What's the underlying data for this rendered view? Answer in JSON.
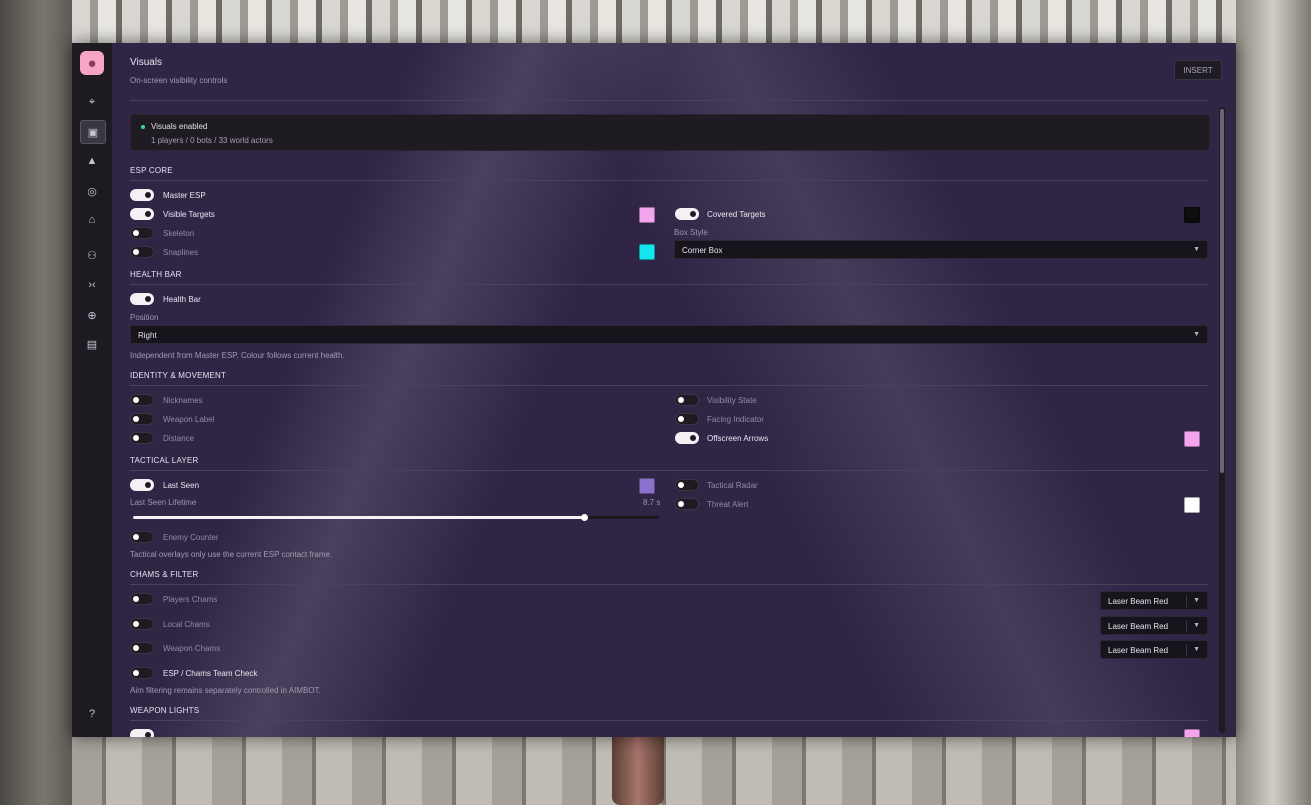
{
  "header": {
    "title": "Visuals",
    "subtitle": "On-screen visibility controls",
    "insert_label": "INSERT"
  },
  "status": {
    "title": "Visuals enabled",
    "counts": "1 players  /  0 bots  /  33 world actors"
  },
  "sidebar": {
    "logo_icon": "cat-face-icon",
    "items": [
      {
        "icon": "crosshair-icon",
        "glyph": "⌖",
        "active": false
      },
      {
        "icon": "visuals-icon",
        "glyph": "▣",
        "active": true
      },
      {
        "icon": "warning-icon",
        "glyph": "▲",
        "active": false
      },
      {
        "icon": "target-icon",
        "glyph": "◎",
        "active": false
      },
      {
        "icon": "inbox-icon",
        "glyph": "⌂",
        "active": false
      },
      {
        "icon": "users-icon",
        "glyph": "⚇",
        "active": false
      },
      {
        "icon": "code-icon",
        "glyph": "›‹",
        "active": false
      },
      {
        "icon": "settings-icon",
        "glyph": "⊕",
        "active": false
      },
      {
        "icon": "media-icon",
        "glyph": "▤",
        "active": false
      }
    ],
    "help_icon": "help-icon"
  },
  "sections": {
    "esp_core": "ESP CORE",
    "health_bar": "HEALTH BAR",
    "identity": "IDENTITY & MOVEMENT",
    "tactical": "TACTICAL LAYER",
    "chams": "CHAMS & FILTER",
    "weapon_lights": "WEAPON LIGHTS"
  },
  "esp_core": {
    "master_esp": {
      "label": "Master ESP",
      "on": true
    },
    "visible_targets": {
      "label": "Visible Targets",
      "on": true,
      "color": "#f3a6ef"
    },
    "skeleton": {
      "label": "Skeleton",
      "on": false
    },
    "snaplines": {
      "label": "Snaplines",
      "on": false,
      "color": "#16e6f0"
    },
    "covered_targets": {
      "label": "Covered Targets",
      "on": true,
      "color": "#0d0d0f"
    },
    "box_style": {
      "caption": "Box Style",
      "value": "Corner Box"
    }
  },
  "health_bar": {
    "toggle": {
      "label": "Health Bar",
      "on": true
    },
    "position": {
      "caption": "Position",
      "value": "Right"
    },
    "note": "Independent from Master ESP. Colour follows current health."
  },
  "identity": {
    "nicknames": {
      "label": "Nicknames",
      "on": false
    },
    "weapon_label": {
      "label": "Weapon Label",
      "on": false
    },
    "distance": {
      "label": "Distance",
      "on": false
    },
    "visibility_state": {
      "label": "Visibility State",
      "on": false
    },
    "facing_indicator": {
      "label": "Facing Indicator",
      "on": false
    },
    "offscreen_arrows": {
      "label": "Offscreen Arrows",
      "on": true,
      "color": "#f3a6ef"
    }
  },
  "tactical": {
    "last_seen": {
      "label": "Last Seen",
      "on": true,
      "color": "#8a73cc"
    },
    "lifetime": {
      "caption": "Last Seen Lifetime",
      "value": "8.7 s",
      "fraction": 0.86
    },
    "enemy_counter": {
      "label": "Enemy Counter",
      "on": false
    },
    "tactical_radar": {
      "label": "Tactical Radar",
      "on": false
    },
    "threat_alert": {
      "label": "Threat Alert",
      "on": false,
      "color": "#ffffff"
    },
    "note": "Tactical overlays only use the current ESP contact frame."
  },
  "chams": {
    "players": {
      "label": "Players Chams",
      "on": false,
      "material": "Laser Beam Red"
    },
    "local": {
      "label": "Local Chams",
      "on": false,
      "material": "Laser Beam Red"
    },
    "weapon": {
      "label": "Weapon Chams",
      "on": false,
      "material": "Laser Beam Red"
    },
    "team_check": {
      "label": "ESP / Chams Team Check",
      "on": false
    },
    "note": "Aim filtering remains separately controlled in AIMBOT."
  },
  "colors": {
    "panel": "#312546",
    "rail": "#1d1a22",
    "accent_green": "#3fd29a"
  }
}
